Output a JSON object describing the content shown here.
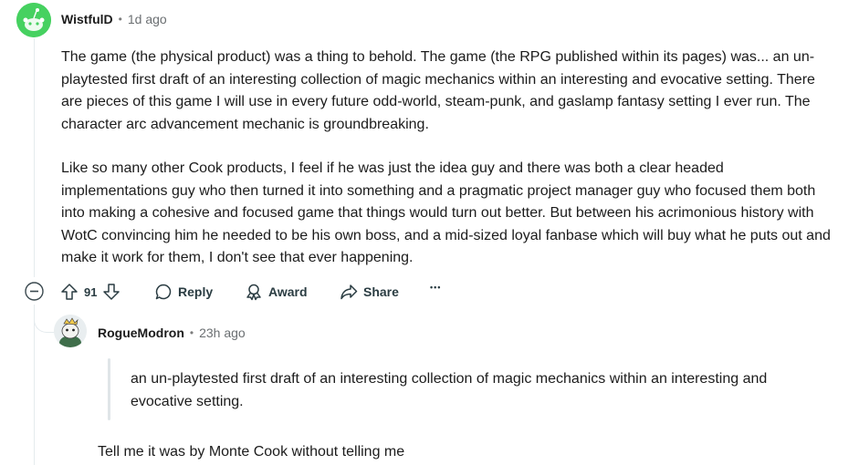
{
  "comment1": {
    "username": "WistfulD",
    "separator": "•",
    "time": "1d ago",
    "paragraphs": [
      "The game (the physical product) was a thing to behold. The game (the RPG published within its pages) was... an un-playtested first draft of an interesting collection of magic mechanics within an interesting and evocative setting. There are pieces of this game I will use in every future odd-world, steam-punk, and gaslamp fantasy setting I ever run. The character arc advancement mechanic is groundbreaking.",
      "Like so many other Cook products, I feel if he was just the idea guy and there was both a clear headed implementations guy who then turned it into something and a pragmatic project manager guy who focused them both into making a cohesive and focused game that things would turn out better. But between his acrimonious history with WotC convincing him he needed to be his own boss, and a mid-sized loyal fanbase which will buy what he puts out and make it work for them, I don't see that ever happening."
    ],
    "vote_count": "91",
    "reply_label": "Reply",
    "award_label": "Award",
    "share_label": "Share",
    "more_label": "•••"
  },
  "comment2": {
    "username": "RogueModron",
    "separator": "•",
    "time": "23h ago",
    "quote": "an un-playtested first draft of an interesting collection of magic mechanics within an interesting and evocative setting.",
    "text": "Tell me it was by Monte Cook without telling me"
  },
  "colors": {
    "avatar1": "#46d160",
    "thread_line": "#e5ebee",
    "action_text": "#2a3c42"
  }
}
